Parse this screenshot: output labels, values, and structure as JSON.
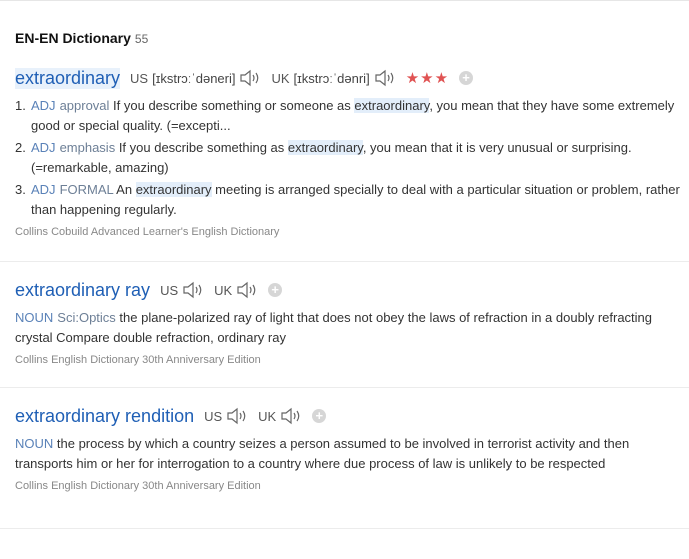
{
  "header": {
    "title": "EN-EN Dictionary",
    "count": "55"
  },
  "entry1": {
    "headword": "extraordinary",
    "us_label": "US",
    "us_phonetic": "[ɪkstrɔːˈdəneri]",
    "uk_label": "UK",
    "uk_phonetic": "[ɪkstrɔːˈdənri]",
    "stars": "★★★",
    "senses": [
      {
        "num": "1.",
        "pos": "ADJ",
        "label": "approval",
        "pre": " If you describe something or someone as ",
        "hl": "extraordinary",
        "post": ", you mean that they have some extremely good or special quality. (=excepti..."
      },
      {
        "num": "2.",
        "pos": "ADJ",
        "label": "emphasis",
        "pre": " If you describe something as ",
        "hl": "extraordinary",
        "post": ", you mean that it is very unusual or surprising. (=remarkable, amazing)"
      },
      {
        "num": "3.",
        "pos": "ADJ",
        "label": "FORMAL",
        "pre": " An ",
        "hl": "extraordinary",
        "post": " meeting is arranged specially to deal with a particular situation or problem, rather than happening regularly."
      }
    ],
    "source": "Collins Cobuild Advanced Learner's English Dictionary"
  },
  "entry2": {
    "headword": "extraordinary ray",
    "us_label": "US",
    "uk_label": "UK",
    "pos": "NOUN",
    "label": "Sci:Optics",
    "definition": " the plane-polarized ray of light that does not obey the laws of refraction in a doubly refracting crystal Compare double refraction, ordinary ray",
    "source": "Collins English Dictionary 30th Anniversary Edition"
  },
  "entry3": {
    "headword": "extraordinary rendition",
    "us_label": "US",
    "uk_label": "UK",
    "pos": "NOUN",
    "definition": " the process by which a country seizes a person assumed to be involved in terrorist activity and then transports him or her for interrogation to a country where due process of law is unlikely to be respected",
    "source": "Collins English Dictionary 30th Anniversary Edition"
  },
  "icons": {
    "audio": "speaker-icon",
    "add": "plus-icon",
    "rating": "star-icon"
  },
  "colors": {
    "headword": "#1f5fb5",
    "stars": "#e05353",
    "highlight": "#e3eefa"
  }
}
